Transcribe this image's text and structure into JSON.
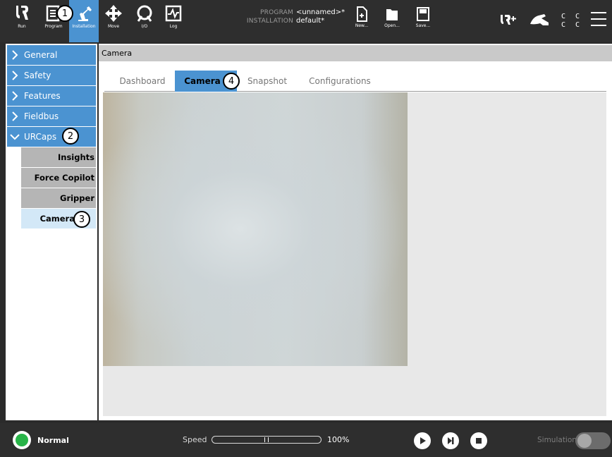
{
  "topbar": {
    "buttons": [
      {
        "id": "run",
        "label": "Run",
        "icon": "ur-logo-icon"
      },
      {
        "id": "program",
        "label": "Program",
        "icon": "program-icon"
      },
      {
        "id": "installation",
        "label": "Installation",
        "icon": "robot-arm-icon"
      },
      {
        "id": "move",
        "label": "Move",
        "icon": "move-arrows-icon"
      },
      {
        "id": "io",
        "label": "I/O",
        "icon": "io-icon"
      },
      {
        "id": "log",
        "label": "Log",
        "icon": "log-icon"
      }
    ],
    "program_key": "PROGRAM",
    "program_value": "<unnamed>*",
    "installation_key": "INSTALLATION",
    "installation_value": "default*",
    "file_buttons": [
      {
        "id": "new",
        "label": "New...",
        "icon": "new-file-icon"
      },
      {
        "id": "open",
        "label": "Open...",
        "icon": "open-folder-icon"
      },
      {
        "id": "save",
        "label": "Save...",
        "icon": "save-icon"
      }
    ],
    "cc_text": "C C\nC C",
    "right_icons": [
      "urplus-icon",
      "teach-pendant-icon",
      "menu-icon"
    ]
  },
  "sidebar": {
    "items": [
      {
        "label": "General",
        "expanded": false
      },
      {
        "label": "Safety",
        "expanded": false
      },
      {
        "label": "Features",
        "expanded": false
      },
      {
        "label": "Fieldbus",
        "expanded": false
      },
      {
        "label": "URCaps",
        "expanded": true
      }
    ],
    "subitems": [
      {
        "label": "Insights",
        "selected": false
      },
      {
        "label": "Force Copilot",
        "selected": false
      },
      {
        "label": "Gripper",
        "selected": false
      },
      {
        "label": "Camera",
        "selected": true
      }
    ]
  },
  "main": {
    "breadcrumb": "Camera",
    "tabs": [
      {
        "label": "Dashboard",
        "active": false
      },
      {
        "label": "Camera",
        "active": true
      },
      {
        "label": "Snapshot",
        "active": false
      },
      {
        "label": "Configurations",
        "active": false
      }
    ]
  },
  "callouts": [
    "1",
    "2",
    "3",
    "4"
  ],
  "bottombar": {
    "status": "Normal",
    "speed_label": "Speed",
    "speed_value": "100%",
    "speed_fraction": 1.0,
    "simulation_label": "Simulation",
    "controls": [
      "play-icon",
      "step-icon",
      "stop-icon"
    ]
  },
  "colors": {
    "accent": "#4b93d1",
    "status_ok": "#28b448",
    "bar_bg": "#2e2e2e"
  }
}
